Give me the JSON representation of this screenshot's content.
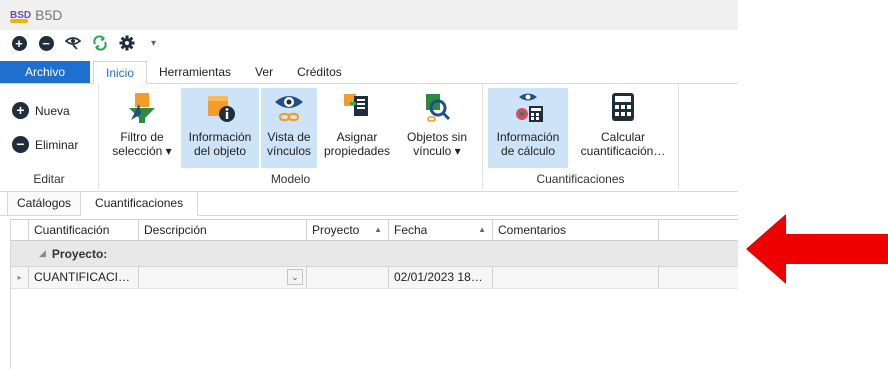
{
  "app": {
    "logo_text": "BSD",
    "title": "B5D"
  },
  "qat": {
    "dropdown_glyph": "▾"
  },
  "tabs": [
    "Archivo",
    "Inicio",
    "Herramientas",
    "Ver",
    "Créditos"
  ],
  "ribbon": {
    "editar": {
      "label": "Editar",
      "nueva": "Nueva",
      "eliminar": "Eliminar"
    },
    "modelo": {
      "label": "Modelo",
      "filtro": [
        "Filtro de",
        "selección ▾"
      ],
      "info_objeto": [
        "Información",
        "del objeto"
      ],
      "vista": [
        "Vista de",
        "vínculos"
      ],
      "asignar": [
        "Asignar",
        "propiedades"
      ],
      "objetos": [
        "Objetos sin",
        "vínculo ▾"
      ]
    },
    "cuant": {
      "label": "Cuantificaciones",
      "info_calc": [
        "Información",
        "de cálculo"
      ],
      "calcular": [
        "Calcular",
        "cuantificación…"
      ]
    }
  },
  "doc_tabs": [
    "Catálogos",
    "Cuantificaciones"
  ],
  "grid": {
    "columns": [
      "Cuantificación",
      "Descripción",
      "Proyecto",
      "Fecha",
      "Comentarios"
    ],
    "sort_glyph": "▲",
    "group_label": "Proyecto:",
    "group_caret": "◢",
    "row_indicator": "▸",
    "rows": [
      {
        "cuantificacion": "CUANTIFICACI…",
        "descripcion": "",
        "proyecto": "",
        "fecha": "02/01/2023 18…",
        "comentarios": ""
      }
    ]
  },
  "colors": {
    "accent": "#1e6fd0",
    "selected": "#cde3f7",
    "arrow": "#ee0000"
  }
}
